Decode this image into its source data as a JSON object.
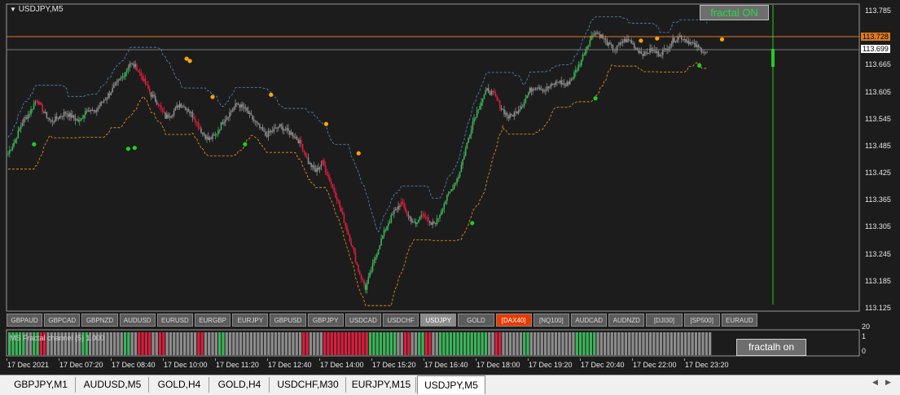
{
  "header": {
    "symbol_label": "USDJPY,M5"
  },
  "price_axis": {
    "ticks": [
      "113.785",
      "113.728",
      "113.665",
      "113.605",
      "113.545",
      "113.485",
      "113.425",
      "113.365",
      "113.305",
      "113.245",
      "113.185",
      "113.125"
    ],
    "orange_line": "113.728",
    "current_price": "113.699"
  },
  "badges": {
    "fractal_on": "fractal ON",
    "fractalh_on": "fractalh on"
  },
  "symbol_buttons": [
    {
      "label": "GBPAUD"
    },
    {
      "label": "GBPCAD"
    },
    {
      "label": "GBPNZD"
    },
    {
      "label": "AUDUSD"
    },
    {
      "label": "EURUSD"
    },
    {
      "label": "EURGBP"
    },
    {
      "label": "EURJPY"
    },
    {
      "label": "GBPUSD"
    },
    {
      "label": "GBPJPY"
    },
    {
      "label": "USDCAD"
    },
    {
      "label": "USDCHF"
    },
    {
      "label": "USDJPY",
      "state": "active"
    },
    {
      "label": "GOLD"
    },
    {
      "label": "[DAX40]",
      "state": "highlight"
    },
    {
      "label": "[NQ100]"
    },
    {
      "label": "AUDCAD"
    },
    {
      "label": "AUDNZD"
    },
    {
      "label": "[DJI30]"
    },
    {
      "label": "[SP500]"
    },
    {
      "label": "EURAUD"
    }
  ],
  "indicator": {
    "label": "MS Fractal channel (5) 1.000",
    "scale_top": "20",
    "scale_1": "1",
    "scale_0": "0"
  },
  "time_axis": [
    "17 Dec 2021",
    "17 Dec 07:20",
    "17 Dec 08:40",
    "17 Dec 10:00",
    "17 Dec 11:20",
    "17 Dec 12:40",
    "17 Dec 14:00",
    "17 Dec 15:20",
    "17 Dec 16:40",
    "17 Dec 18:00",
    "17 Dec 19:20",
    "17 Dec 20:40",
    "17 Dec 22:00",
    "17 Dec 23:20"
  ],
  "chart_tabs": [
    "GBPJPY,M1",
    "AUDUSD,M5",
    "GOLD,H4",
    "GOLD,H4",
    "USDCHF,M30",
    "EURJPY,M15",
    "USDJPY,M5"
  ],
  "active_tab": 6,
  "colors": {
    "background": "#1c1c1c",
    "up": "#3cb45a",
    "down": "#d81e3c",
    "neutral": "#8c8c8c",
    "fractal_up": "#ffa500",
    "fractal_down": "#22cc22",
    "channel_upper": "#4f7fb6",
    "channel_lower": "#e08a1a",
    "level_line": "#e07a22"
  },
  "chart_data": {
    "type": "candlestick",
    "series": [
      {
        "values": [
          [
            0,
            113.47
          ],
          [
            5,
            113.5
          ],
          [
            10,
            113.54
          ],
          [
            15,
            113.56
          ],
          [
            20,
            113.59
          ],
          [
            25,
            113.56
          ],
          [
            30,
            113.54
          ],
          [
            35,
            113.55
          ],
          [
            40,
            113.56
          ],
          [
            45,
            113.55
          ],
          [
            50,
            113.54
          ],
          [
            55,
            113.57
          ],
          [
            60,
            113.56
          ],
          [
            65,
            113.58
          ],
          [
            70,
            113.6
          ],
          [
            75,
            113.62
          ],
          [
            80,
            113.64
          ],
          [
            85,
            113.67
          ],
          [
            90,
            113.66
          ],
          [
            95,
            113.63
          ],
          [
            100,
            113.6
          ],
          [
            105,
            113.58
          ],
          [
            110,
            113.55
          ],
          [
            115,
            113.56
          ],
          [
            120,
            113.58
          ],
          [
            125,
            113.57
          ],
          [
            130,
            113.55
          ],
          [
            135,
            113.52
          ],
          [
            140,
            113.5
          ],
          [
            145,
            113.51
          ],
          [
            150,
            113.54
          ],
          [
            155,
            113.56
          ],
          [
            160,
            113.58
          ],
          [
            165,
            113.57
          ],
          [
            170,
            113.55
          ],
          [
            175,
            113.53
          ],
          [
            180,
            113.51
          ],
          [
            185,
            113.52
          ],
          [
            190,
            113.53
          ],
          [
            195,
            113.52
          ],
          [
            200,
            113.51
          ],
          [
            205,
            113.49
          ],
          [
            210,
            113.45
          ],
          [
            215,
            113.43
          ],
          [
            220,
            113.45
          ],
          [
            225,
            113.41
          ],
          [
            230,
            113.37
          ],
          [
            235,
            113.32
          ],
          [
            240,
            113.27
          ],
          [
            245,
            113.21
          ],
          [
            250,
            113.17
          ],
          [
            255,
            113.22
          ],
          [
            260,
            113.27
          ],
          [
            265,
            113.31
          ],
          [
            270,
            113.34
          ],
          [
            275,
            113.36
          ],
          [
            280,
            113.33
          ],
          [
            285,
            113.31
          ],
          [
            290,
            113.34
          ],
          [
            295,
            113.31
          ],
          [
            300,
            113.32
          ],
          [
            305,
            113.36
          ],
          [
            310,
            113.39
          ],
          [
            315,
            113.42
          ],
          [
            320,
            113.48
          ],
          [
            325,
            113.54
          ],
          [
            330,
            113.58
          ],
          [
            335,
            113.61
          ],
          [
            340,
            113.6
          ],
          [
            345,
            113.57
          ],
          [
            350,
            113.55
          ],
          [
            355,
            113.56
          ],
          [
            360,
            113.58
          ],
          [
            365,
            113.61
          ],
          [
            370,
            113.62
          ],
          [
            375,
            113.61
          ],
          [
            380,
            113.62
          ],
          [
            385,
            113.63
          ],
          [
            390,
            113.62
          ],
          [
            395,
            113.64
          ],
          [
            400,
            113.67
          ],
          [
            405,
            113.71
          ],
          [
            410,
            113.74
          ],
          [
            415,
            113.73
          ],
          [
            420,
            113.71
          ],
          [
            425,
            113.7
          ],
          [
            430,
            113.72
          ],
          [
            435,
            113.72
          ],
          [
            440,
            113.7
          ],
          [
            445,
            113.69
          ],
          [
            450,
            113.7
          ],
          [
            455,
            113.69
          ],
          [
            460,
            113.7
          ],
          [
            465,
            113.72
          ],
          [
            470,
            113.73
          ],
          [
            475,
            113.72
          ],
          [
            480,
            113.71
          ],
          [
            485,
            113.7
          ],
          [
            490,
            113.69
          ]
        ]
      }
    ],
    "fractals_upper": [
      [
        55,
        113.68
      ],
      [
        56,
        113.675
      ],
      [
        63,
        113.595
      ],
      [
        81,
        113.6
      ],
      [
        98,
        113.535
      ],
      [
        108,
        113.47
      ],
      [
        195,
        113.72
      ],
      [
        200,
        113.725
      ],
      [
        220,
        113.723
      ]
    ],
    "fractals_lower": [
      [
        8,
        113.49
      ],
      [
        37,
        113.48
      ],
      [
        39,
        113.482
      ],
      [
        73,
        113.49
      ],
      [
        143,
        113.315
      ],
      [
        181,
        113.592
      ],
      [
        213,
        113.665
      ]
    ]
  }
}
